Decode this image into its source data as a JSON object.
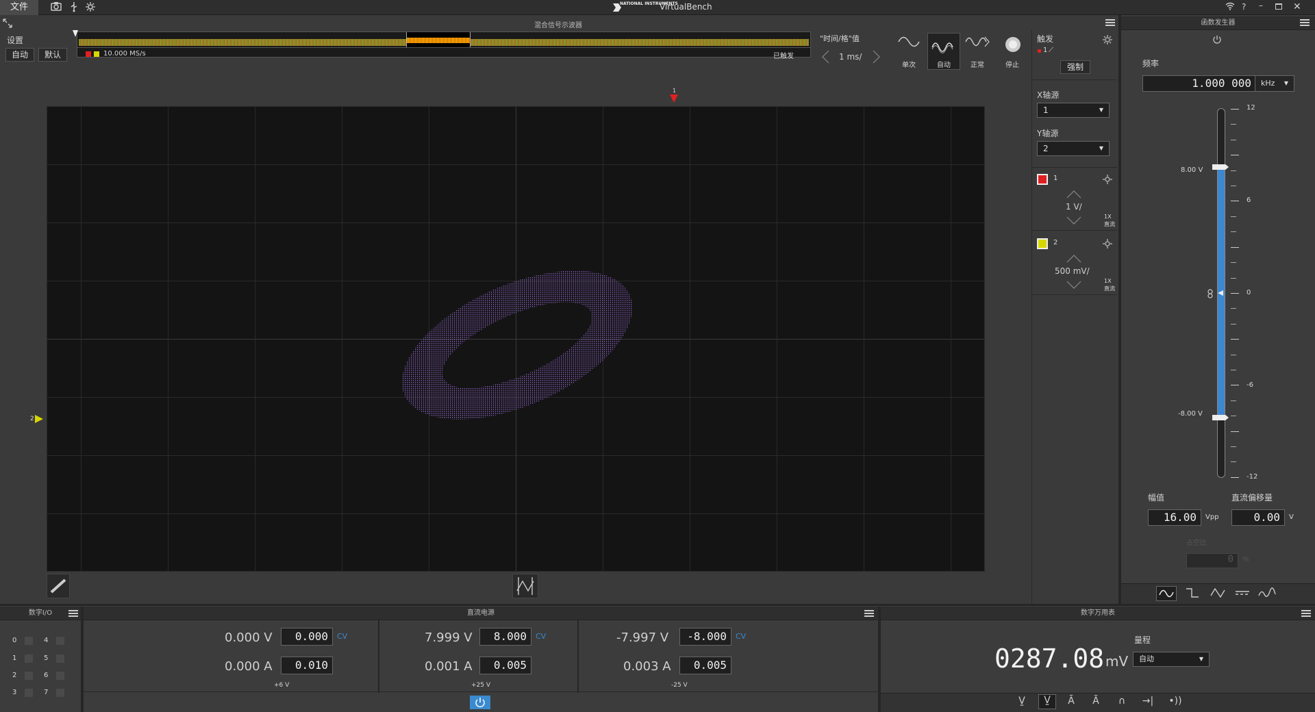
{
  "app": {
    "title": "VirtualBench",
    "brand": "NATIONAL INSTRUMENTS",
    "file_menu": "文件"
  },
  "colors": {
    "accent": "#3a8ad0",
    "ch1": "#e02020",
    "ch2": "#d8d800",
    "trace": "#9a6ad8",
    "screen_bg": "#141414"
  },
  "scope": {
    "header": "混合信号示波器",
    "settings_label": "设置",
    "auto_button": "自动",
    "default_button": "默认",
    "sample_rate": "10.000 MS/s",
    "trigger_status": "已触发",
    "time_div_label": "\"时间/格\"值",
    "time_div_value": "1 ms/",
    "acq_modes": [
      "单次",
      "自动",
      "正常",
      "停止"
    ],
    "trigger_marker": "1",
    "ch2_marker": "2"
  },
  "trigger": {
    "label": "触发",
    "source": "1",
    "force_button": "强制",
    "x_source_label": "X轴源",
    "x_source_value": "1",
    "y_source_label": "Y轴源",
    "y_source_value": "2"
  },
  "channels": [
    {
      "id": "1",
      "scale": "1 V/",
      "probe": "1X",
      "coupling": "直流"
    },
    {
      "id": "2",
      "scale": "500 mV/",
      "probe": "1X",
      "coupling": "直流"
    }
  ],
  "fgen": {
    "header": "函数发生器",
    "freq_label": "频率",
    "freq_value": "1.000 000",
    "freq_unit": "kHz",
    "scale_ticks": [
      "12",
      "6",
      "0",
      "-6",
      "-12"
    ],
    "upper_level": "8.00 V",
    "lower_level": "-8.00 V",
    "amp_label": "幅值",
    "amp_value": "16.00",
    "amp_unit": "Vpp",
    "offset_label": "直流偏移量",
    "offset_value": "0.00",
    "offset_unit": "V",
    "duty_label": "占空比",
    "duty_value": "0",
    "duty_unit": "%"
  },
  "dio": {
    "header": "数字I/O",
    "left": [
      "0",
      "1",
      "2",
      "3"
    ],
    "right": [
      "4",
      "5",
      "6",
      "7"
    ]
  },
  "dc_supply": {
    "header": "直流电源",
    "channels": [
      {
        "v_meas": "0.000 V",
        "v_set": "0.000",
        "i_meas": "0.000 A",
        "i_set": "0.010",
        "mode": "CV",
        "name": "+6 V"
      },
      {
        "v_meas": "7.999 V",
        "v_set": "8.000",
        "i_meas": "0.001 A",
        "i_set": "0.005",
        "mode": "CV",
        "name": "+25 V"
      },
      {
        "v_meas": "-7.997 V",
        "v_set": "-8.000",
        "i_meas": "0.003 A",
        "i_set": "0.005",
        "mode": "CV",
        "name": "-25 V"
      }
    ]
  },
  "dmm": {
    "header": "数字万用表",
    "reading": "0287.08",
    "unit": "mV",
    "range_label": "量程",
    "range_value": "自动"
  }
}
